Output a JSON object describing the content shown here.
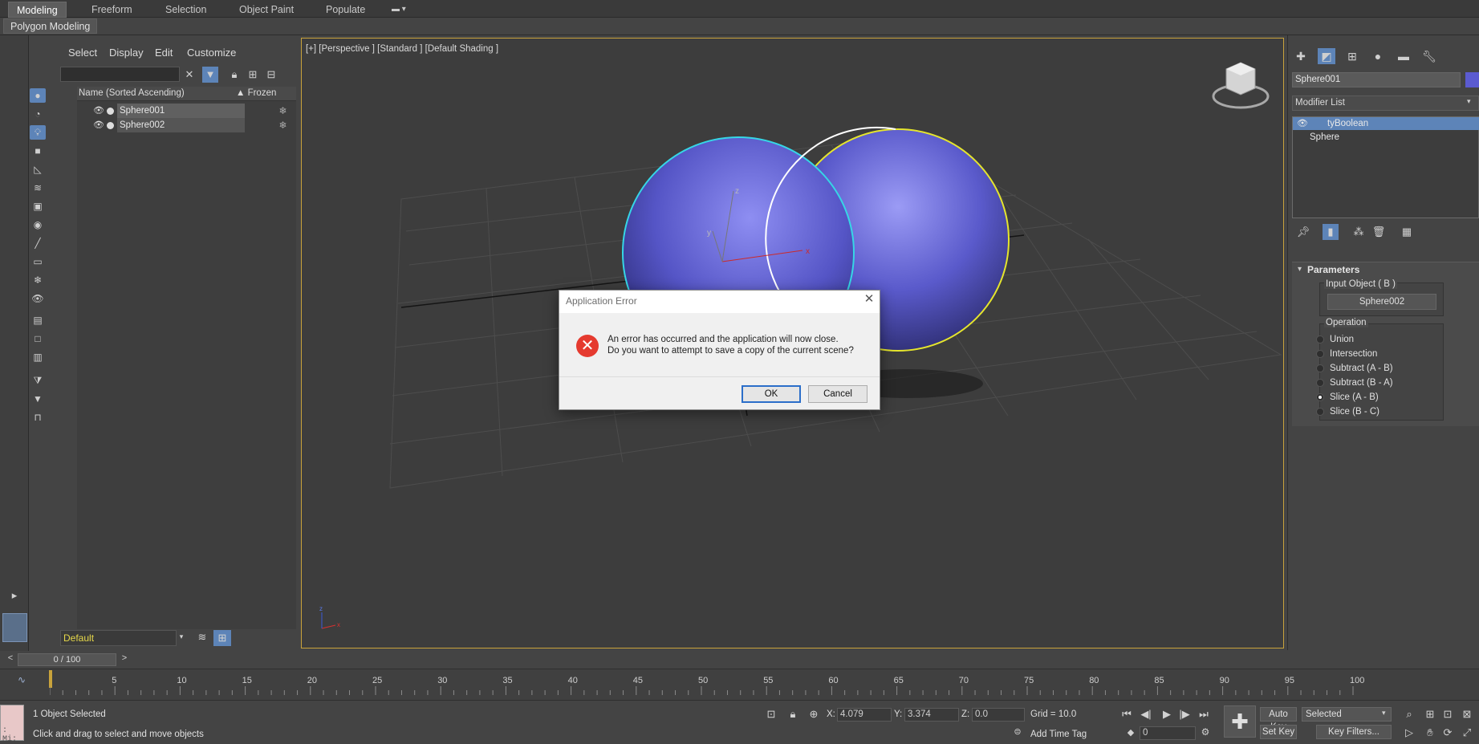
{
  "ribbon": {
    "tabs": [
      "Modeling",
      "Freeform",
      "Selection",
      "Object Paint",
      "Populate"
    ],
    "active_tab": "Modeling",
    "sub_panel": "Polygon Modeling"
  },
  "scene_explorer": {
    "menu": [
      "Select",
      "Display",
      "Edit",
      "Customize"
    ],
    "columns": {
      "name": "Name (Sorted Ascending)",
      "frozen": "▲ Frozen"
    },
    "rows": [
      {
        "name": "Sphere001",
        "selected": true
      },
      {
        "name": "Sphere002",
        "selected": false
      }
    ],
    "layer": "Default"
  },
  "viewport": {
    "label": "[+] [Perspective ] [Standard ] [Default Shading ]",
    "axis_labels": {
      "x": "x",
      "y": "y",
      "z": "z"
    }
  },
  "command_panel": {
    "object_name": "Sphere001",
    "modifier_list": "Modifier List",
    "stack": [
      "tyBoolean",
      "Sphere"
    ],
    "parameters": {
      "title": "Parameters",
      "input_object_label": "Input Object ( B )",
      "input_object_value": "Sphere002",
      "operation_label": "Operation",
      "operations": [
        "Union",
        "Intersection",
        "Subtract (A - B)",
        "Subtract (B - A)",
        "Slice (A - B)",
        "Slice (B - C)"
      ],
      "selected_operation": "Slice (A - B)"
    }
  },
  "timeline": {
    "slider": "0 / 100",
    "ticks": [
      "5",
      "10",
      "15",
      "20",
      "25",
      "30",
      "35",
      "40",
      "45",
      "50",
      "55",
      "60",
      "65",
      "70",
      "75",
      "80",
      "85",
      "90",
      "95",
      "100"
    ]
  },
  "status": {
    "selection": "1 Object Selected",
    "prompt": "Click and drag to select and move objects",
    "x_label": "X:",
    "x_value": "4.079",
    "y_label": "Y:",
    "y_value": "3.374",
    "z_label": "Z:",
    "z_value": "0.0",
    "grid": "Grid = 10.0",
    "add_time_tag": "Add Time Tag",
    "auto_key": "Auto Key",
    "set_key": "Set Key",
    "key_mode": "Selected",
    "key_filters": "Key Filters...",
    "frame": "0",
    "maxscript_hint": ": Mi:"
  },
  "dialog": {
    "title": "Application Error",
    "line1": "An error has occurred and the application will now close.",
    "line2": "Do you want to attempt to save a copy of the current scene?",
    "ok": "OK",
    "cancel": "Cancel"
  },
  "colors": {
    "accent": "#5d84b8",
    "sphere": "#5b5bd0",
    "viewport_border": "#c9a33b",
    "selected_outline_a": "#36d6e6",
    "selected_outline_b": "#e5e52d",
    "error": "#e53a2f",
    "layer_text": "#e6d84a"
  }
}
